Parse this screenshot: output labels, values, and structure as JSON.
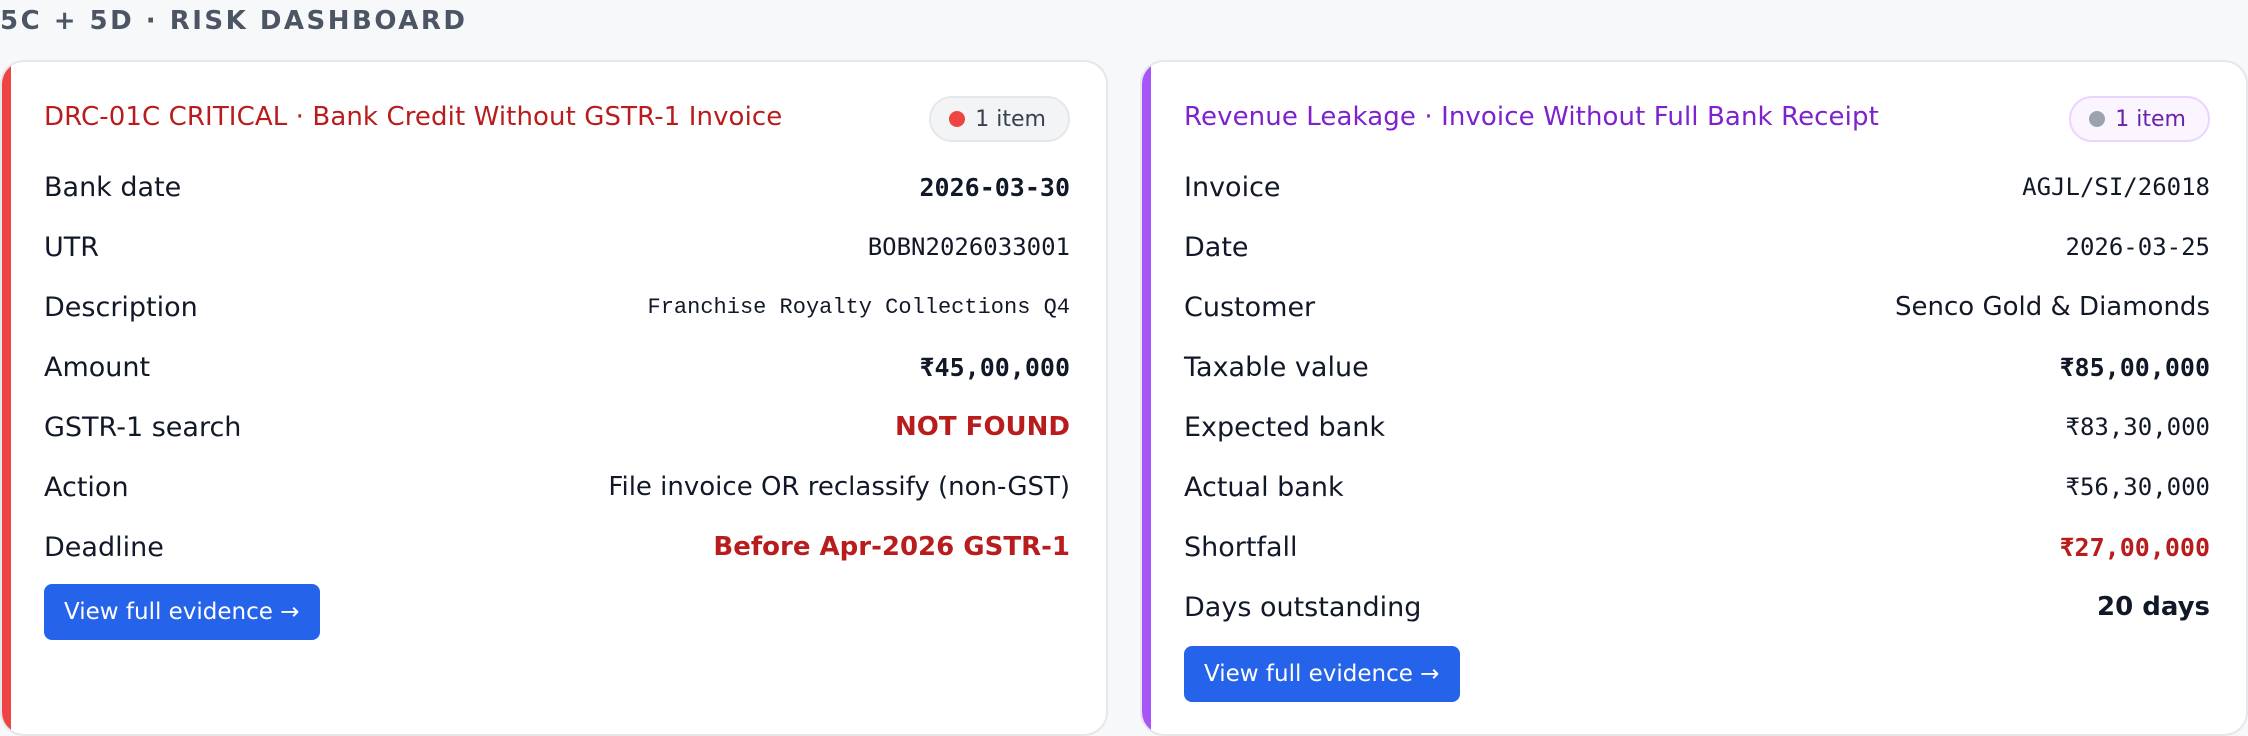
{
  "page_heading": "5C + 5D · RISK DASHBOARD",
  "colors": {
    "critical_accent": "#ef4444",
    "leakage_accent": "#a855f7",
    "button": "#2563eb",
    "danger_text": "#b91c1c"
  },
  "cards": [
    {
      "title": "DRC-01C CRITICAL · Bank Credit Without GSTR-1 Invoice",
      "badge": {
        "label": "1 item",
        "dot_color": "#ef4444"
      },
      "rows": [
        {
          "label": "Bank date",
          "value": "2026-03-30"
        },
        {
          "label": "UTR",
          "value": "BOBN2026033001"
        },
        {
          "label": "Description",
          "value": "Franchise Royalty Collections Q4"
        },
        {
          "label": "Amount",
          "value": "₹45,00,000"
        },
        {
          "label": "GSTR-1 search",
          "value": "NOT FOUND"
        },
        {
          "label": "Action",
          "value": "File invoice OR reclassify (non-GST)"
        },
        {
          "label": "Deadline",
          "value": "Before Apr-2026 GSTR-1"
        }
      ],
      "button_label": "View full evidence →"
    },
    {
      "title": "Revenue Leakage · Invoice Without Full Bank Receipt",
      "badge": {
        "label": "1 item",
        "dot_color": "#9ca3af"
      },
      "rows": [
        {
          "label": "Invoice",
          "value": "AGJL/SI/26018"
        },
        {
          "label": "Date",
          "value": "2026-03-25"
        },
        {
          "label": "Customer",
          "value": "Senco Gold & Diamonds"
        },
        {
          "label": "Taxable value",
          "value": "₹85,00,000"
        },
        {
          "label": "Expected bank",
          "value": "₹83,30,000"
        },
        {
          "label": "Actual bank",
          "value": "₹56,30,000"
        },
        {
          "label": "Shortfall",
          "value": "₹27,00,000"
        },
        {
          "label": "Days outstanding",
          "value": "20 days"
        }
      ],
      "button_label": "View full evidence →"
    }
  ]
}
